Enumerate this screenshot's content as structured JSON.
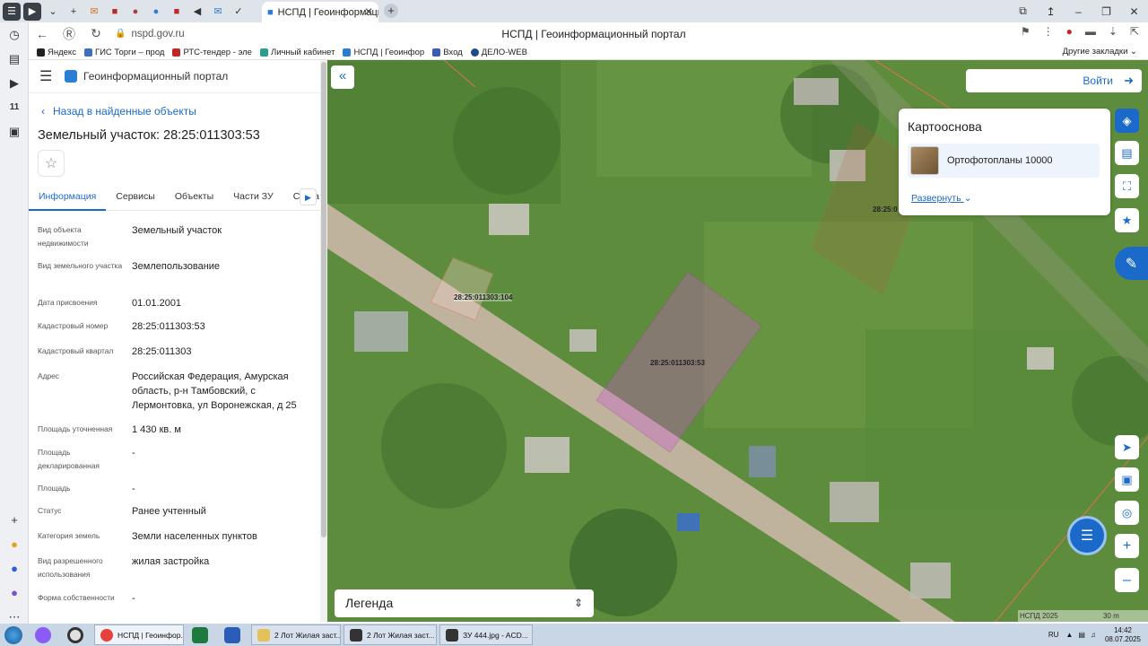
{
  "browser": {
    "active_tab_title": "НСПД | Геоинформаци",
    "url": "nspd.gov.ru",
    "page_title": "НСПД | Геоинформационный портал",
    "bookmarks": [
      "Яндекс",
      "ГИС Торги – прод",
      "РТС-тендер - эле",
      "Личный кабинет",
      "НСПД | Геоинфор",
      "Вход",
      "ДЕЛО-WEB"
    ],
    "other_bookmarks": "Другие закладки"
  },
  "panel": {
    "portal_name": "Геоинформационный портал",
    "back_link": "Назад в найденные объекты",
    "title": "Земельный участок: 28:25:011303:53",
    "tabs": [
      "Информация",
      "Сервисы",
      "Объекты",
      "Части ЗУ",
      "Соста"
    ],
    "properties": [
      {
        "label": "Вид объекта недвижимости",
        "value": "Земельный участок"
      },
      {
        "label": "Вид земельного участка",
        "value": "Землепользование"
      },
      {
        "label": "Дата присвоения",
        "value": "01.01.2001"
      },
      {
        "label": "Кадастровый номер",
        "value": "28:25:011303:53"
      },
      {
        "label": "Кадастровый квартал",
        "value": "28:25:011303"
      },
      {
        "label": "Адрес",
        "value": "Российская Федерация, Амурская область, р-н Тамбовский, с Лермонтовка, ул Воронежская, д 25"
      },
      {
        "label": "Площадь уточненная",
        "value": "1 430 кв. м"
      },
      {
        "label": "Площадь декларированная",
        "value": "-"
      },
      {
        "label": "Площадь",
        "value": "-"
      },
      {
        "label": "Статус",
        "value": "Ранее учтенный"
      },
      {
        "label": "Категория земель",
        "value": "Земли населенных пунктов"
      },
      {
        "label": "Вид разрешенного использования",
        "value": "жилая застройка"
      },
      {
        "label": "Форма собственности",
        "value": "-"
      }
    ]
  },
  "map": {
    "login_label": "Войти",
    "basemap_title": "Картооснова",
    "basemap_item": "Ортофотопланы 10000",
    "basemap_expand": "Развернуть",
    "legend_label": "Легенда",
    "parcel_labels": [
      "28:25:011303:53",
      "28:25:011303:104",
      "28:25:0"
    ],
    "attribution": "НСПД 2025",
    "scale_text": "30 m",
    "highlight_color": "#b03fb0"
  },
  "taskbar": {
    "windows": [
      "НСПД | Геоинфор...",
      "2 Лот Жилая заст...",
      "2 Лот Жилая заст...",
      "ЗУ 444.jpg - ACD..."
    ],
    "lang": "RU",
    "time": "14:42",
    "date": "08.07.2025"
  }
}
